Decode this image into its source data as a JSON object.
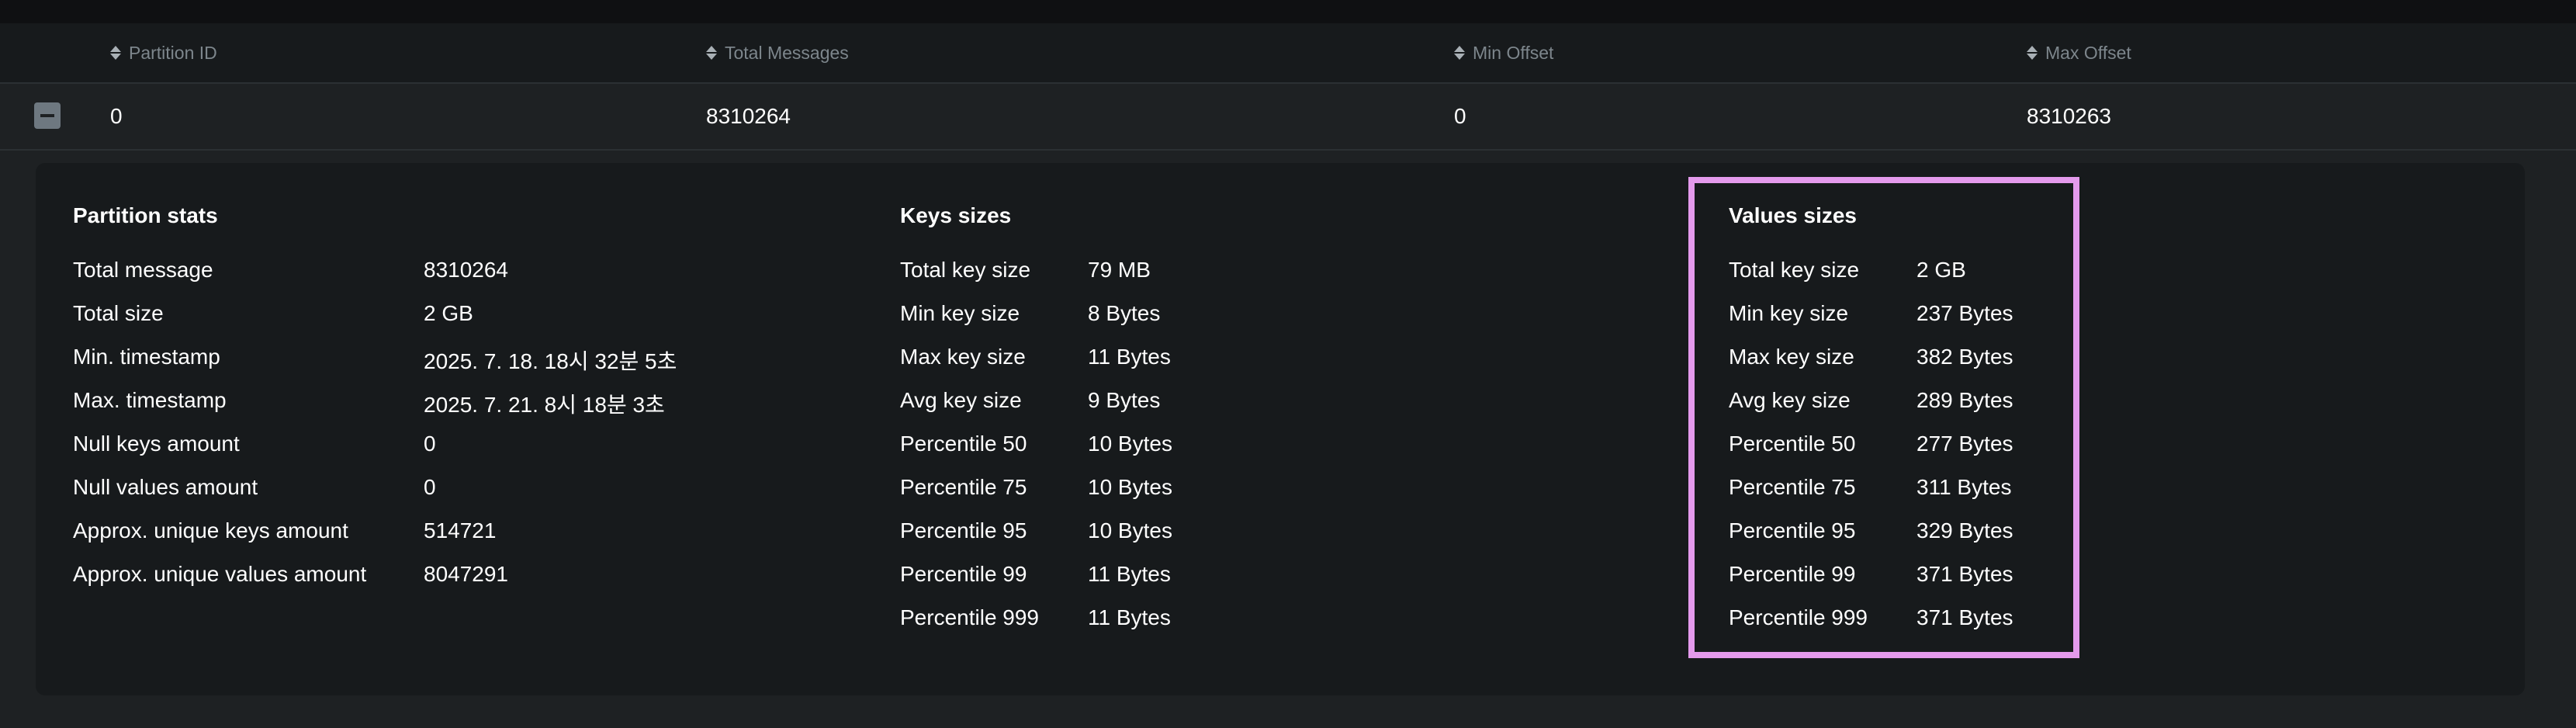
{
  "table": {
    "headers": [
      "Partition ID",
      "Total Messages",
      "Min Offset",
      "Max Offset"
    ],
    "row": [
      "0",
      "8310264",
      "0",
      "8310263"
    ]
  },
  "partition_stats": {
    "title": "Partition stats",
    "items": [
      {
        "label": "Total message",
        "value": "8310264"
      },
      {
        "label": "Total size",
        "value": "2 GB"
      },
      {
        "label": "Min. timestamp",
        "value": "2025. 7. 18. 18시 32분 5초"
      },
      {
        "label": "Max. timestamp",
        "value": "2025. 7. 21. 8시 18분 3초"
      },
      {
        "label": "Null keys amount",
        "value": "0"
      },
      {
        "label": "Null values amount",
        "value": "0"
      },
      {
        "label": "Approx. unique keys amount",
        "value": "514721"
      },
      {
        "label": "Approx. unique values amount",
        "value": "8047291"
      }
    ]
  },
  "keys_sizes": {
    "title": "Keys sizes",
    "items": [
      {
        "label": "Total key size",
        "value": "79 MB"
      },
      {
        "label": "Min key size",
        "value": "8 Bytes"
      },
      {
        "label": "Max key size",
        "value": "11 Bytes"
      },
      {
        "label": "Avg key size",
        "value": "9 Bytes"
      },
      {
        "label": "Percentile 50",
        "value": "10 Bytes"
      },
      {
        "label": "Percentile 75",
        "value": "10 Bytes"
      },
      {
        "label": "Percentile 95",
        "value": "10 Bytes"
      },
      {
        "label": "Percentile 99",
        "value": "11 Bytes"
      },
      {
        "label": "Percentile 999",
        "value": "11 Bytes"
      }
    ]
  },
  "values_sizes": {
    "title": "Values sizes",
    "items": [
      {
        "label": "Total key size",
        "value": "2 GB"
      },
      {
        "label": "Min key size",
        "value": "237 Bytes"
      },
      {
        "label": "Max key size",
        "value": "382 Bytes"
      },
      {
        "label": "Avg key size",
        "value": "289 Bytes"
      },
      {
        "label": "Percentile 50",
        "value": "277 Bytes"
      },
      {
        "label": "Percentile 75",
        "value": "311 Bytes"
      },
      {
        "label": "Percentile 95",
        "value": "329 Bytes"
      },
      {
        "label": "Percentile 99",
        "value": "371 Bytes"
      },
      {
        "label": "Percentile 999",
        "value": "371 Bytes"
      }
    ]
  },
  "colors": {
    "highlight": "#e49aec",
    "header_text": "#7d868c",
    "panel_bg": "#171a1c"
  }
}
